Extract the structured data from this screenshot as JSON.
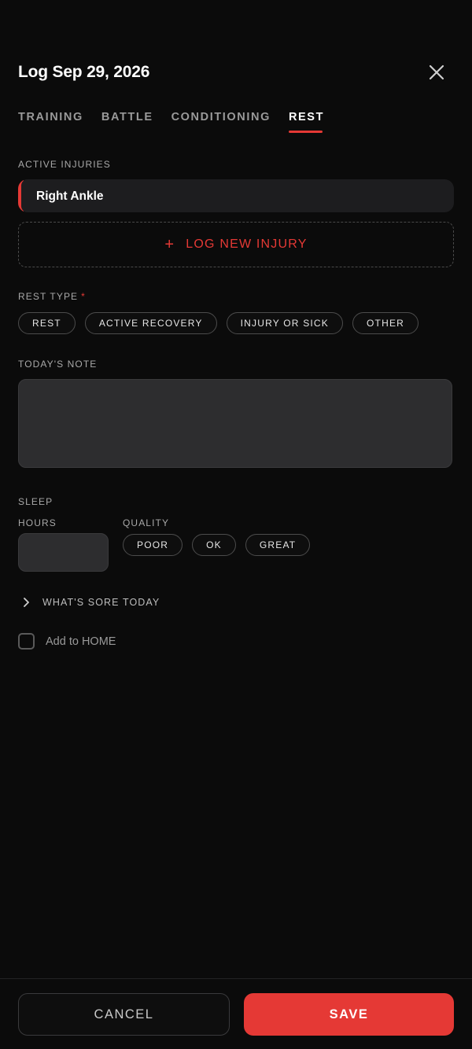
{
  "header": {
    "title": "Log Sep 29, 2026",
    "close_icon": "close-icon"
  },
  "tabs": [
    {
      "label": "TRAINING",
      "active": false
    },
    {
      "label": "BATTLE",
      "active": false
    },
    {
      "label": "CONDITIONING",
      "active": false
    },
    {
      "label": "REST",
      "active": true
    }
  ],
  "injuries": {
    "section_label": "ACTIVE INJURIES",
    "items": [
      {
        "name": "Right Ankle"
      }
    ],
    "log_new_plus": "+",
    "log_new_label": "LOG NEW INJURY"
  },
  "rest_type": {
    "label": "REST TYPE",
    "required_mark": "*",
    "options": [
      "REST",
      "ACTIVE RECOVERY",
      "INJURY OR SICK",
      "OTHER"
    ],
    "selected": null
  },
  "note": {
    "label": "TODAY'S NOTE",
    "value": "",
    "placeholder": ""
  },
  "sleep": {
    "label": "SLEEP",
    "hours_label": "HOURS",
    "hours_value": "",
    "quality_label": "QUALITY",
    "quality_options": [
      "POOR",
      "OK",
      "GREAT"
    ],
    "quality_selected": null
  },
  "sore": {
    "label": "WHAT'S SORE TODAY",
    "expanded": false
  },
  "home": {
    "label": "Add to HOME",
    "checked": false
  },
  "footer": {
    "cancel_label": "CANCEL",
    "save_label": "SAVE"
  },
  "colors": {
    "accent": "#e53935",
    "background": "#0b0b0b",
    "input_bg": "#2d2d2f",
    "card_bg": "#1d1d1f"
  }
}
